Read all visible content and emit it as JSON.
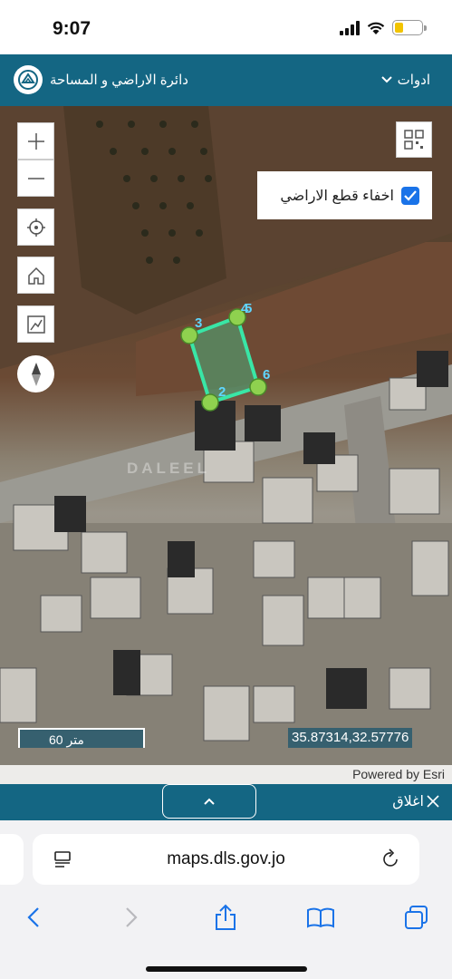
{
  "status_bar": {
    "time": "9:07"
  },
  "header": {
    "title": "دائرة الاراضي و المساحة",
    "tools_label": "ادوات"
  },
  "map": {
    "hide_parcels_label": "اخفاء قطع الاراضي",
    "hide_parcels_checked": true,
    "vertex_labels": [
      "2",
      "3",
      "4",
      "5",
      "6"
    ],
    "scale_label": "60 متر",
    "coordinates": "35.87314,32.57776",
    "attribution": "Powered by Esri",
    "watermark": "DALEEL"
  },
  "bottom_bar": {
    "close_label": "اغلاق"
  },
  "browser": {
    "url": "maps.dls.gov.jo"
  },
  "icons": [
    "zoom-in-icon",
    "zoom-out-icon",
    "locate-icon",
    "home-icon",
    "measure-icon",
    "compass-icon",
    "qr-icon",
    "chevron-down-icon",
    "chevron-up-icon",
    "close-icon",
    "reader-icon",
    "reload-icon",
    "back-icon",
    "forward-icon",
    "share-icon",
    "bookmarks-icon",
    "tabs-icon"
  ],
  "colors": {
    "header": "#146683",
    "parcel": "#39e6a6",
    "vertex": "#8fd14f"
  }
}
